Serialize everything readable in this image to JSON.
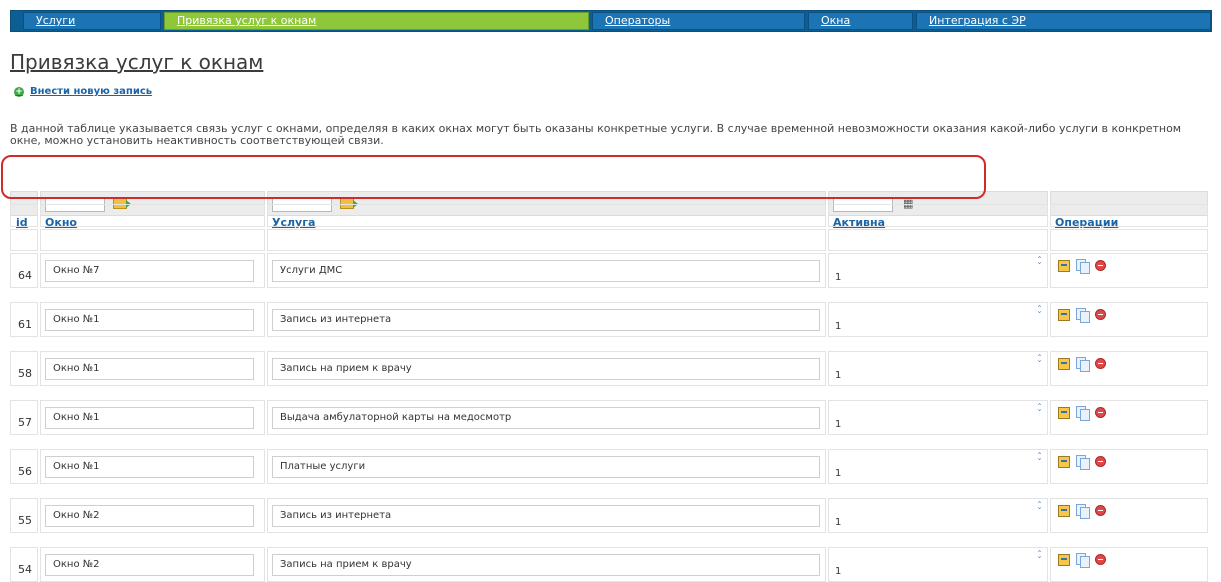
{
  "nav": {
    "tabs": [
      {
        "label": "Услуги",
        "active": false
      },
      {
        "label": "Привязка услуг к окнам",
        "active": true
      },
      {
        "label": "Операторы",
        "active": false
      },
      {
        "label": "Окна",
        "active": false
      },
      {
        "label": "Интеграция с ЭР",
        "active": false
      }
    ]
  },
  "page": {
    "title": "Привязка услуг к окнам",
    "add_link": "Внести новую запись",
    "description": "В данной таблице указывается связь услуг с окнами, определяя в каких окнах могут быть оказаны конкретные услуги. В случае временной невозможности оказания какой-либо услуги в конкретном окне, можно установить неактивность соответствующей связи."
  },
  "table": {
    "headers": {
      "id": "id",
      "window": "Окно",
      "service": "Услуга",
      "active": "Активна",
      "ops": "Операции"
    },
    "rows": [
      {
        "id": "64",
        "window": "Окно №7",
        "service": "Услуги ДМС",
        "active": "1"
      },
      {
        "id": "61",
        "window": "Окно №1",
        "service": "Запись из интернета",
        "active": "1"
      },
      {
        "id": "58",
        "window": "Окно №1",
        "service": "Запись на прием к врачу",
        "active": "1"
      },
      {
        "id": "57",
        "window": "Окно №1",
        "service": "Выдача амбулаторной карты на медосмотр",
        "active": "1"
      },
      {
        "id": "56",
        "window": "Окно №1",
        "service": "Платные услуги",
        "active": "1"
      },
      {
        "id": "55",
        "window": "Окно №2",
        "service": "Запись из интернета",
        "active": "1"
      },
      {
        "id": "54",
        "window": "Окно №2",
        "service": "Запись на прием к врачу",
        "active": "1"
      }
    ]
  },
  "colors": {
    "nav_bg": "#0b5f93",
    "nav_tab": "#1c74b5",
    "nav_active": "#8ec73a",
    "link": "#1a64a8",
    "annotation": "#d02a2a"
  },
  "icons": [
    "add-icon",
    "go-arrow-icon",
    "calendar-icon",
    "sort-icon",
    "edit-icon",
    "copy-icon",
    "delete-icon"
  ]
}
